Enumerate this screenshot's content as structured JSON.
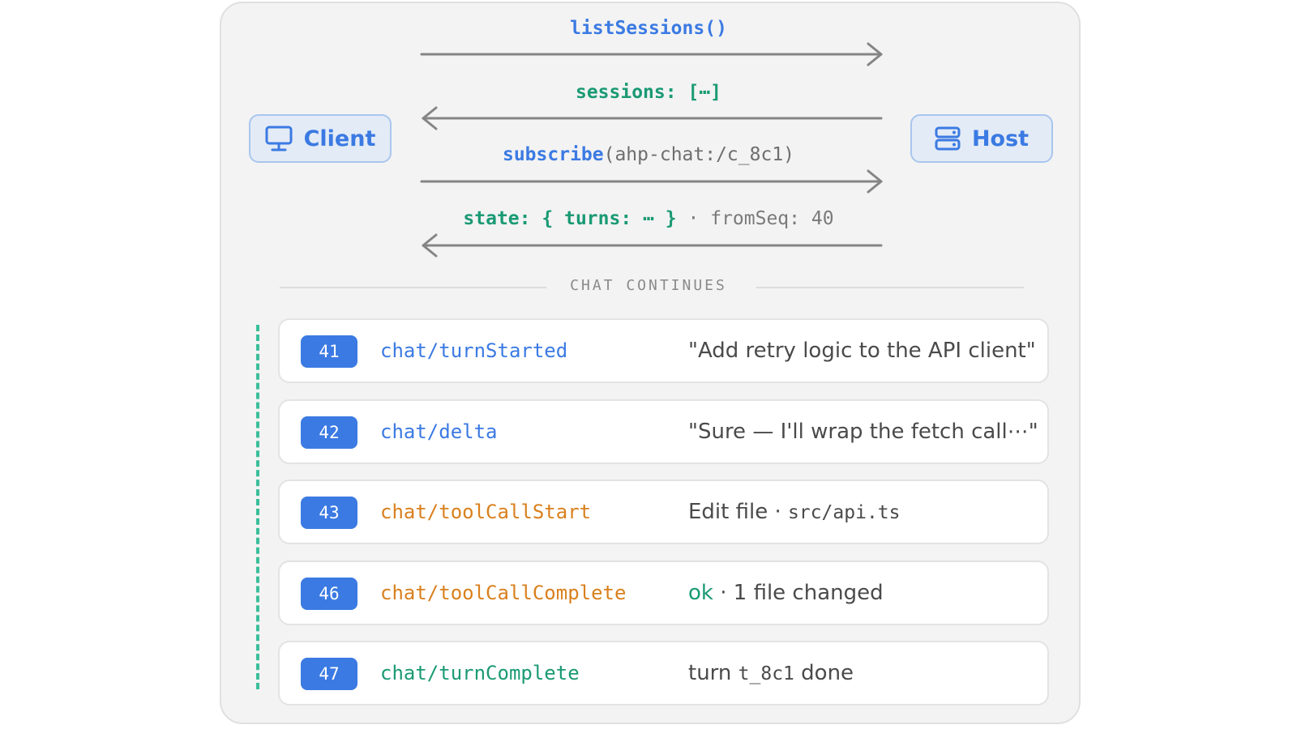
{
  "actors": {
    "client": {
      "label": "Client",
      "icon": "monitor-icon"
    },
    "host": {
      "label": "Host",
      "icon": "server-icon"
    }
  },
  "messages": [
    {
      "direction": "client-to-host",
      "method": "listSessions()"
    },
    {
      "direction": "host-to-client",
      "key": "sessions",
      "colon": ":",
      "value": "[⋯]"
    },
    {
      "direction": "client-to-host",
      "method": "subscribe",
      "args": "(ahp-chat:/c_8c1)"
    },
    {
      "direction": "host-to-client",
      "key": "state",
      "colon": ":",
      "open": "{",
      "inner_key": "turns",
      "inner_value": "⋯",
      "close": "}",
      "sep": "·",
      "extra_key": "fromSeq",
      "extra_value": "40"
    }
  ],
  "divider": {
    "label": "CHAT CONTINUES"
  },
  "events": [
    {
      "seq": "41",
      "name": "chat/turnStarted",
      "kind": "turn",
      "detail_text": "\"Add retry logic to the API client\""
    },
    {
      "seq": "42",
      "name": "chat/delta",
      "kind": "turn",
      "detail_text": "\"Sure — I'll wrap the fetch call⋯\""
    },
    {
      "seq": "43",
      "name": "chat/toolCallStart",
      "kind": "tool",
      "detail_text": "Edit file",
      "detail_sep": "·",
      "detail_code": "src/api.ts"
    },
    {
      "seq": "46",
      "name": "chat/toolCallComplete",
      "kind": "tool",
      "detail_status": "ok",
      "detail_sep": "·",
      "detail_text": "1 file changed"
    },
    {
      "seq": "47",
      "name": "chat/turnComplete",
      "kind": "complete",
      "detail_prefix": "turn",
      "detail_code": "t_8c1",
      "detail_suffix": "done"
    }
  ],
  "colors": {
    "accent_blue": "#3b7ae3",
    "accent_green": "#1a9a73",
    "accent_orange": "#d9801e",
    "timeline_dash": "#3bbf9b"
  }
}
